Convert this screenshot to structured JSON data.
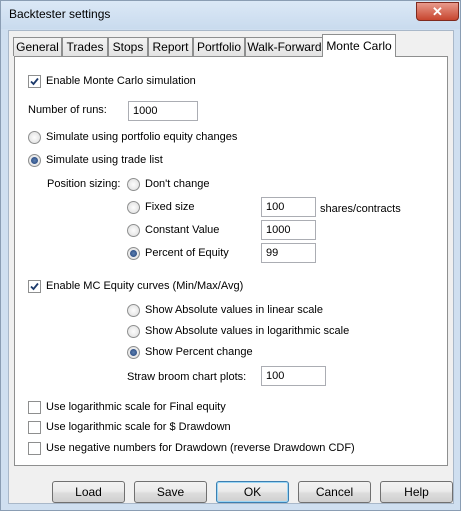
{
  "window": {
    "title": "Backtester settings",
    "close_glyph": "✕"
  },
  "tabs": [
    {
      "label": "General"
    },
    {
      "label": "Trades"
    },
    {
      "label": "Stops"
    },
    {
      "label": "Report"
    },
    {
      "label": "Portfolio"
    },
    {
      "label": "Walk-Forward"
    },
    {
      "label": "Monte Carlo",
      "active": true
    }
  ],
  "monte_carlo": {
    "enable_label": "Enable Monte Carlo simulation",
    "enable_checked": true,
    "runs_label": "Number of runs:",
    "runs_value": "1000",
    "sim_portfolio_label": "Simulate using portfolio equity changes",
    "sim_trades_label": "Simulate using trade list",
    "sim_mode_selected": "trade_list",
    "position_sizing_label": "Position sizing:",
    "sizing_options": [
      {
        "label": "Don't change"
      },
      {
        "label": "Fixed size",
        "value": "100",
        "unit": "shares/contracts"
      },
      {
        "label": "Constant Value",
        "value": "1000"
      },
      {
        "label": "Percent of Equity",
        "value": "99",
        "selected": true
      }
    ],
    "curves_label": "Enable MC Equity curves (Min/Max/Avg)",
    "curves_checked": true,
    "curve_options": [
      {
        "label": "Show Absolute values in linear scale"
      },
      {
        "label": "Show Absolute values in logarithmic scale"
      },
      {
        "label": "Show Percent change",
        "selected": true
      }
    ],
    "straw_label": "Straw broom chart plots:",
    "straw_value": "100",
    "log_final_label": "Use logarithmic scale for Final equity",
    "log_dd_label": "Use logarithmic scale for $ Drawdown",
    "neg_dd_label": "Use negative numbers for Drawdown (reverse Drawdown CDF)"
  },
  "buttons": {
    "load": "Load",
    "save": "Save",
    "ok": "OK",
    "cancel": "Cancel",
    "help": "Help"
  },
  "icons": {
    "checkmark": "checkmark-icon",
    "close": "close-icon"
  }
}
